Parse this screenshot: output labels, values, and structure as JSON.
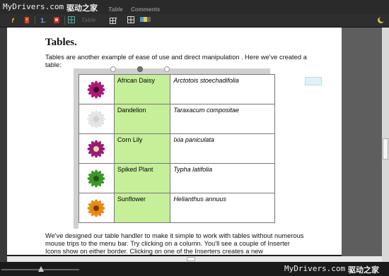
{
  "watermark": {
    "top_site": "MyDrivers.com",
    "top_cn": "驱动之家",
    "bottom_site": "MyDrivers.com",
    "bottom_cn": "驱动之家"
  },
  "menu": {
    "table": "Table",
    "comments": "Comments"
  },
  "toolbar": {
    "function_glyph": "f",
    "numbered_list": "1.",
    "table_label": "Table"
  },
  "document": {
    "title": "Tables.",
    "intro": "Tables are another example of ease of use and direct manipulation . Here we've created a table:",
    "outro": "We've designed our table handler to make it simple to work with tables without numerous mouse trips to the menu bar. Try clicking on a column. You'll see a couple of Inserter Icons show on either border. Clicking on one of the Inserters creates a new"
  },
  "table": {
    "rows": [
      {
        "name": "African Daisy",
        "latin": "Arctotois stoechadifolia",
        "color": "#b0157a",
        "center": "#3a1020"
      },
      {
        "name": "Dandelion",
        "latin": "Taraxacum compositae",
        "color": "#e8e8e8",
        "center": "#cfcfcf"
      },
      {
        "name": "Corn Lily",
        "latin": "Ixia paniculata",
        "color": "#a01a78",
        "center": "#e8e0a0"
      },
      {
        "name": "Spiked Plant",
        "latin": "Typha latifolia",
        "color": "#3c9a2a",
        "center": "#1f5a12"
      },
      {
        "name": "Sunflower",
        "latin": "Helianthus annuus",
        "color": "#f08a10",
        "center": "#7a3a05"
      }
    ]
  },
  "colors": {
    "name_column": "#c6ef9a",
    "chrome": "#2a2a2a"
  }
}
